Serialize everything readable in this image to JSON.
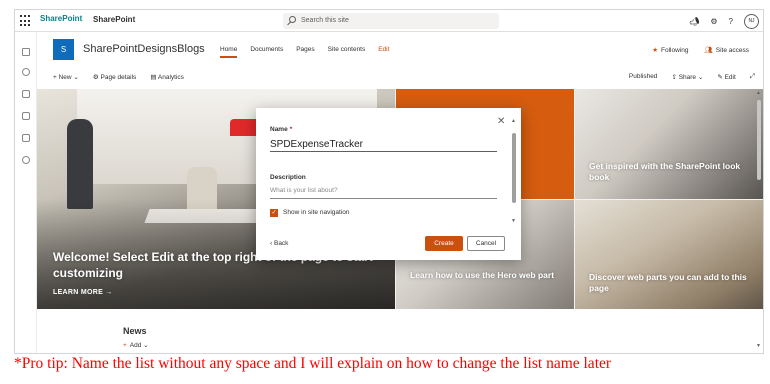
{
  "suitebar": {
    "logo_text": "SharePoint",
    "app_title": "SharePoint",
    "search_placeholder": "Search this site",
    "avatar_initials": "NJ"
  },
  "site": {
    "logo_letter": "S",
    "name": "SharePointDesignsBlogs",
    "nav": [
      "Home",
      "Documents",
      "Pages",
      "Site contents",
      "Edit"
    ],
    "following_label": "Following",
    "site_access_label": "Site access"
  },
  "commandbar": {
    "new_label": "New",
    "page_details_label": "Page details",
    "analytics_label": "Analytics",
    "published_label": "Published",
    "share_label": "Share",
    "edit_label": "Edit"
  },
  "hero": {
    "main_text": "Welcome! Select Edit at the top right of the page to start customizing",
    "main_link": "LEARN MORE →",
    "tile_bridge": "Get inspired with the SharePoint look book",
    "tile_hall": "Learn how to use the Hero web part",
    "tile_office": "Discover web parts you can add to this page"
  },
  "news": {
    "title": "News",
    "add_label": "Add"
  },
  "dialog": {
    "name_label": "Name",
    "name_value": "SPDExpenseTracker",
    "description_label": "Description",
    "description_placeholder": "What is your list about?",
    "show_in_nav_label": "Show in site navigation",
    "show_in_nav_checked": true,
    "back_label": "Back",
    "create_label": "Create",
    "cancel_label": "Cancel"
  },
  "tip": "*Pro tip: Name the list without any space and I will explain on how to change the list name later",
  "colors": {
    "accent": "#ca5010",
    "orange_tile": "#d65c0f",
    "tip_red": "#ff0000"
  }
}
